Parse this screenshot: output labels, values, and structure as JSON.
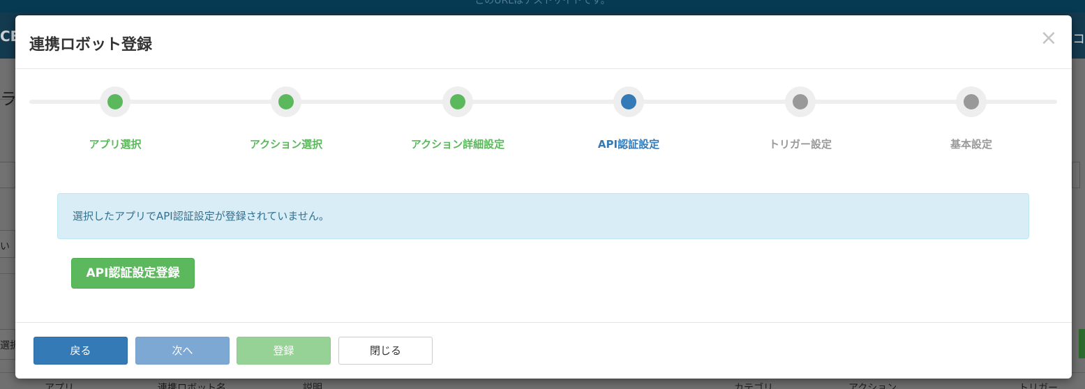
{
  "background": {
    "banner_text": "このURLはテストサイトです。",
    "nav_left": "CE",
    "nav_right": "コ",
    "fragments": [
      "ラ",
      "い",
      "選択"
    ],
    "table_headers": [
      "アプリ",
      "連携ロボット名",
      "説明",
      "カテゴリ",
      "アクション",
      "トリガー"
    ]
  },
  "modal": {
    "title": "連携ロボット登録",
    "close_icon": "close-icon",
    "steps": [
      {
        "label": "アプリ選択",
        "state": "done",
        "color": "#5cb85c"
      },
      {
        "label": "アクション選択",
        "state": "done",
        "color": "#5cb85c"
      },
      {
        "label": "アクション詳細設定",
        "state": "done",
        "color": "#5cb85c"
      },
      {
        "label": "API認証設定",
        "state": "current",
        "color": "#337ab7"
      },
      {
        "label": "トリガー設定",
        "state": "pending",
        "color": "#999999"
      },
      {
        "label": "基本設定",
        "state": "pending",
        "color": "#999999"
      }
    ],
    "alert_text": "選択したアプリでAPI認証設定が登録されていません。",
    "api_button_label": "API認証設定登録",
    "footer": {
      "back_label": "戻る",
      "next_label": "次へ",
      "save_label": "登録",
      "close_label": "閉じる"
    }
  },
  "colors": {
    "done": "#5cb85c",
    "current": "#337ab7",
    "pending": "#999999",
    "alert_bg": "#d9edf7",
    "alert_text": "#31708f"
  }
}
